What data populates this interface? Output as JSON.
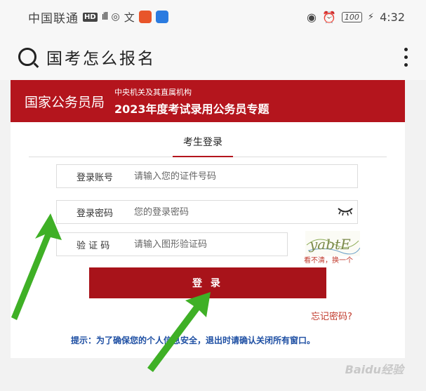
{
  "statusbar": {
    "carrier": "中国联通",
    "hd": "HD",
    "network": "4G",
    "battery": "100",
    "time": "4:32"
  },
  "search": {
    "query": "国考怎么报名"
  },
  "banner": {
    "org": "国家公务员局",
    "sub_small": "中央机关及其直属机构",
    "sub_title": "2023年度考试录用公务员专题"
  },
  "tab": {
    "label": "考生登录"
  },
  "form": {
    "account_label": "登录账号",
    "account_placeholder": "请输入您的证件号码",
    "password_label": "登录密码",
    "password_placeholder": "您的登录密码",
    "captcha_label": "验 证 码",
    "captcha_placeholder": "请输入图形验证码",
    "captcha_text": "yabtE",
    "captcha_refresh": "看不清，换一个",
    "login_button": "登 录",
    "forgot": "忘记密码?"
  },
  "tip": "提示：为了确保您的个人信息安全，退出时请确认关闭所有窗口。",
  "watermark": "Baidu经验",
  "colors": {
    "brand_red": "#b4151d",
    "tip_blue": "#1e4fa3",
    "arrow_green": "#3fb026"
  }
}
